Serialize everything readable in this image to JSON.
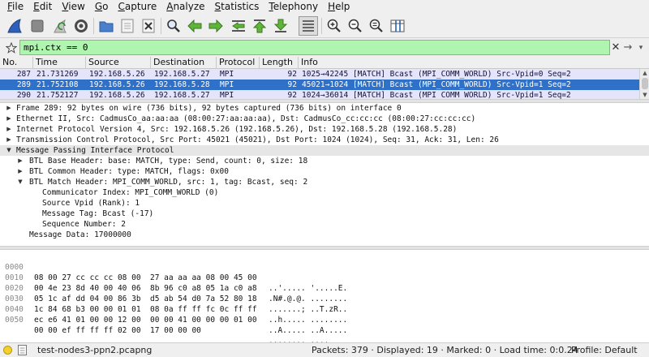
{
  "menubar": {
    "items": [
      {
        "mnemonic": "F",
        "rest": "ile"
      },
      {
        "mnemonic": "E",
        "rest": "dit"
      },
      {
        "mnemonic": "V",
        "rest": "iew"
      },
      {
        "mnemonic": "G",
        "rest": "o"
      },
      {
        "mnemonic": "C",
        "rest": "apture"
      },
      {
        "mnemonic": "A",
        "rest": "nalyze"
      },
      {
        "mnemonic": "S",
        "rest": "tatistics"
      },
      {
        "mnemonic": "T",
        "rest": "elephony"
      },
      {
        "mnemonic": "H",
        "rest": "elp"
      }
    ]
  },
  "toolbar": {
    "icons": [
      "shark-fin-start-icon",
      "stop-capture-icon",
      "restart-capture-icon",
      "capture-options-icon",
      "open-file-icon",
      "save-file-icon",
      "close-file-icon",
      "find-packet-icon",
      "go-back-icon",
      "go-forward-icon",
      "go-to-packet-icon",
      "first-packet-icon",
      "last-packet-icon",
      "autoscroll-icon",
      "zoom-in-icon",
      "zoom-out-icon",
      "normal-size-icon",
      "resize-columns-icon"
    ]
  },
  "filter": {
    "value": "mpi.ctx == 0"
  },
  "packet_list": {
    "columns": [
      "No.",
      "Time",
      "Source",
      "Destination",
      "Protocol",
      "Length",
      "Info"
    ],
    "rows": [
      {
        "no": "287",
        "time": "21.731269",
        "source": "192.168.5.26",
        "destination": "192.168.5.27",
        "protocol": "MPI",
        "length": "92",
        "info": "1025→42245 [MATCH] Bcast (MPI_COMM_WORLD) Src-Vpid=0 Seq=2",
        "selected": false
      },
      {
        "no": "289",
        "time": "21.752108",
        "source": "192.168.5.26",
        "destination": "192.168.5.28",
        "protocol": "MPI",
        "length": "92",
        "info": "45021→1024 [MATCH] Bcast (MPI_COMM_WORLD) Src-Vpid=1 Seq=2",
        "selected": true
      },
      {
        "no": "290",
        "time": "21.752127",
        "source": "192.168.5.26",
        "destination": "192.168.5.27",
        "protocol": "MPI",
        "length": "92",
        "info": "1024→36014 [MATCH] Bcast (MPI_COMM_WORLD) Src-Vpid=1 Seq=2",
        "selected": false
      }
    ]
  },
  "details": {
    "rows": [
      {
        "level": 0,
        "state": "closed",
        "text": "Frame 289: 92 bytes on wire (736 bits), 92 bytes captured (736 bits) on interface 0"
      },
      {
        "level": 0,
        "state": "closed",
        "text": "Ethernet II, Src: CadmusCo_aa:aa:aa (08:00:27:aa:aa:aa), Dst: CadmusCo_cc:cc:cc (08:00:27:cc:cc:cc)"
      },
      {
        "level": 0,
        "state": "closed",
        "text": "Internet Protocol Version 4, Src: 192.168.5.26 (192.168.5.26), Dst: 192.168.5.28 (192.168.5.28)"
      },
      {
        "level": 0,
        "state": "closed",
        "text": "Transmission Control Protocol, Src Port: 45021 (45021), Dst Port: 1024 (1024), Seq: 31, Ack: 31, Len: 26"
      },
      {
        "level": 0,
        "state": "open",
        "text": "Message Passing Interface Protocol"
      },
      {
        "level": 1,
        "state": "closed",
        "text": "BTL Base Header: base: MATCH, type: Send, count: 0, size: 18"
      },
      {
        "level": 1,
        "state": "closed",
        "text": "BTL Common Header: type: MATCH, flags: 0x00"
      },
      {
        "level": 1,
        "state": "open",
        "text": "BTL Match Header: MPI_COMM_WORLD, src: 1, tag: Bcast, seq: 2"
      },
      {
        "level": 2,
        "state": "leaf",
        "text": "Communicator Index: MPI_COMM_WORLD (0)"
      },
      {
        "level": 2,
        "state": "leaf",
        "text": "Source Vpid (Rank): 1"
      },
      {
        "level": 2,
        "state": "leaf",
        "text": "Message Tag: Bcast (-17)"
      },
      {
        "level": 2,
        "state": "leaf",
        "text": "Sequence Number: 2"
      },
      {
        "level": 1,
        "state": "leaf",
        "text": "Message Data: 17000000"
      }
    ]
  },
  "bytes": {
    "rows": [
      {
        "offset": "0000",
        "hex": "08 00 27 cc cc cc 08 00  27 aa aa aa 08 00 45 00",
        "ascii": "..'..... '.....E."
      },
      {
        "offset": "0010",
        "hex": "00 4e 23 8d 40 00 40 06  8b 96 c0 a8 05 1a c0 a8",
        "ascii": ".N#.@.@. ........"
      },
      {
        "offset": "0020",
        "hex": "05 1c af dd 04 00 86 3b  d5 ab 54 d0 7a 52 80 18",
        "ascii": ".......; ..T.zR.."
      },
      {
        "offset": "0030",
        "hex": "1c 84 68 b3 00 00 01 01  08 0a ff ff fc 0c ff ff",
        "ascii": "..h..... ........"
      },
      {
        "offset": "0040",
        "hex": "ec e6 41 01 00 00 12 00  00 00 41 00 00 00 01 00",
        "ascii": "..A..... ..A....."
      },
      {
        "offset": "0050",
        "hex": "00 00 ef ff ff ff 02 00  17 00 00 00",
        "ascii": "........ ...."
      }
    ]
  },
  "statusbar": {
    "filename": "test-nodes3-ppn2.pcapng",
    "counts": "Packets: 379 · Displayed: 19 · Marked: 0 · Load time: 0:0.24",
    "profile": "Profile: Default"
  },
  "colors": {
    "filter_valid": "#aff5af",
    "row_normal": "#e4e4fa",
    "row_selected": "#2f71c8",
    "shark_blue": "#2f5fb8"
  }
}
